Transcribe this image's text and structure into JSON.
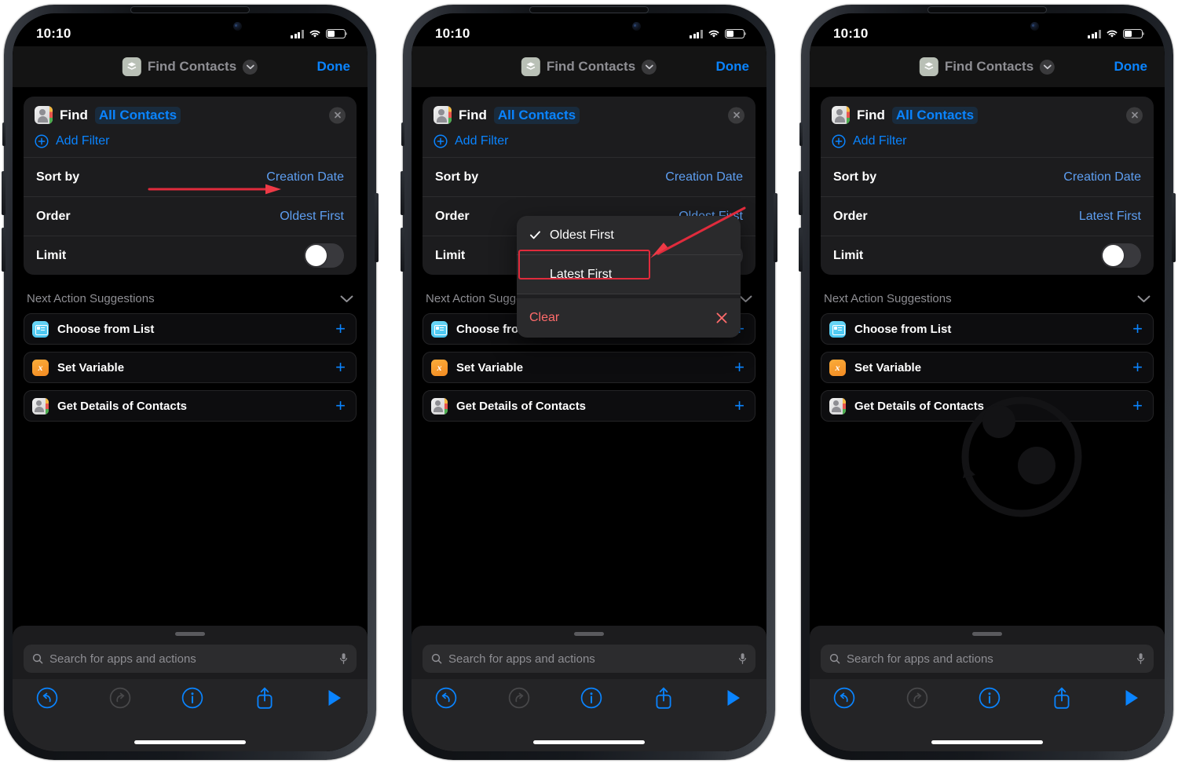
{
  "colors": {
    "accent_blue": "#0a84ff",
    "value_blue": "#5e9ff2",
    "annotation_red": "#e02b3c",
    "destructive_red": "#ff6b6b",
    "card_bg": "#1c1c1e",
    "screen_bg": "#000000",
    "secondary_text": "#8e8e93"
  },
  "status_bar": {
    "time": "10:10",
    "cellular_icon": "signal-bars-icon",
    "wifi_icon": "wifi-icon",
    "battery_icon": "battery-icon",
    "battery_level_percent": 42
  },
  "navbar": {
    "app_icon": "shortcuts-stack-icon",
    "title": "Find Contacts",
    "chevron_icon": "chevron-down-icon",
    "done_label": "Done"
  },
  "action_card": {
    "icon": "contacts-app-icon",
    "verb": "Find",
    "target_token": "All Contacts",
    "clear_icon": "close-circle-icon",
    "add_filter": {
      "icon": "plus-circle-icon",
      "label": "Add Filter"
    },
    "rows": [
      {
        "key": "Sort by",
        "value": "Creation Date",
        "type": "value"
      },
      {
        "key": "Order",
        "value": "Oldest First",
        "type": "value"
      },
      {
        "key": "Limit",
        "value": "",
        "type": "toggle",
        "toggle_on": false
      }
    ]
  },
  "action_card_updated": {
    "rows": [
      {
        "key": "Sort by",
        "value": "Creation Date",
        "type": "value"
      },
      {
        "key": "Order",
        "value": "Latest First",
        "type": "value"
      },
      {
        "key": "Limit",
        "value": "",
        "type": "toggle",
        "toggle_on": false
      }
    ]
  },
  "suggestions": {
    "header": "Next Action Suggestions",
    "collapse_icon": "chevron-down-icon",
    "items": [
      {
        "icon": "choose-from-list-icon",
        "label": "Choose from List",
        "add_icon": "plus-icon"
      },
      {
        "icon": "set-variable-icon",
        "glyph": "x",
        "label": "Set Variable",
        "add_icon": "plus-icon"
      },
      {
        "icon": "get-details-of-contacts-icon",
        "label": "Get Details of Contacts",
        "add_icon": "plus-icon"
      }
    ]
  },
  "bottom_sheet": {
    "grabber": "sheet-grabber",
    "search": {
      "icon": "search-icon",
      "placeholder": "Search for apps and actions",
      "value": "",
      "mic_icon": "microphone-icon"
    },
    "toolbar": [
      {
        "name": "undo-button",
        "icon": "undo-icon",
        "enabled": true
      },
      {
        "name": "redo-button",
        "icon": "redo-icon",
        "enabled": false
      },
      {
        "name": "info-button",
        "icon": "info-icon",
        "enabled": true
      },
      {
        "name": "share-button",
        "icon": "share-icon",
        "enabled": true
      },
      {
        "name": "run-button",
        "icon": "play-icon",
        "enabled": true
      }
    ]
  },
  "order_popup": {
    "items": [
      {
        "label": "Oldest First",
        "checked": true,
        "highlighted": false
      },
      {
        "label": "Latest First",
        "checked": false,
        "highlighted": true
      }
    ],
    "clear": {
      "label": "Clear",
      "icon": "close-x-icon"
    }
  },
  "annotations": {
    "phone1_arrow": "red-arrow-pointing-to-order-value",
    "phone2_arrow": "red-arrow-pointing-to-latest-first",
    "phone2_highlight": "red-box-around-latest-first"
  },
  "panels": [
    {
      "id": "phone-1",
      "caption_state": "order-set-to-oldest-first"
    },
    {
      "id": "phone-2",
      "caption_state": "order-menu-open"
    },
    {
      "id": "phone-3",
      "caption_state": "order-set-to-latest-first"
    }
  ]
}
